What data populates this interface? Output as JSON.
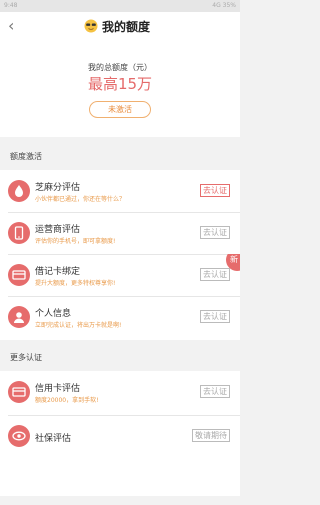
{
  "statusbar": {
    "time": "9:48",
    "indicators": "4G 35%"
  },
  "header": {
    "back_icon": "chevron-left-icon",
    "title": "我的额度"
  },
  "hero": {
    "label": "我的总额度（元）",
    "amount": "最高15万",
    "button": "未激活"
  },
  "sections": {
    "activation": "额度激活",
    "more": "更多认证"
  },
  "activation_items": [
    {
      "icon": "sesame-icon",
      "title": "芝麻分评估",
      "subtitle": "小伙伴都已通过，你还在等什么？",
      "button": "去认证",
      "active": true
    },
    {
      "icon": "phone-icon",
      "title": "运营商评估",
      "subtitle": "评估你的手机号，即可拿额度!",
      "button": "去认证",
      "active": false
    },
    {
      "icon": "card-icon",
      "title": "借记卡绑定",
      "subtitle": "提升大额度，更多特权尊享你!",
      "button": "去认证",
      "active": false,
      "badge": "新"
    },
    {
      "icon": "person-icon",
      "title": "个人信息",
      "subtitle": "立即完成认证，将出万卡就是啊!",
      "button": "去认证",
      "active": false
    }
  ],
  "more_items": [
    {
      "icon": "credit-card-icon",
      "title": "信用卡评估",
      "subtitle": "额度20000，拿到手软!",
      "button": "去认证"
    },
    {
      "icon": "eye-icon",
      "title": "社保评估",
      "subtitle": "",
      "button": "敬请期待"
    }
  ],
  "colors": {
    "accent": "#e66c6c",
    "orange": "#e98b3a",
    "background": "#f2f2f2"
  }
}
